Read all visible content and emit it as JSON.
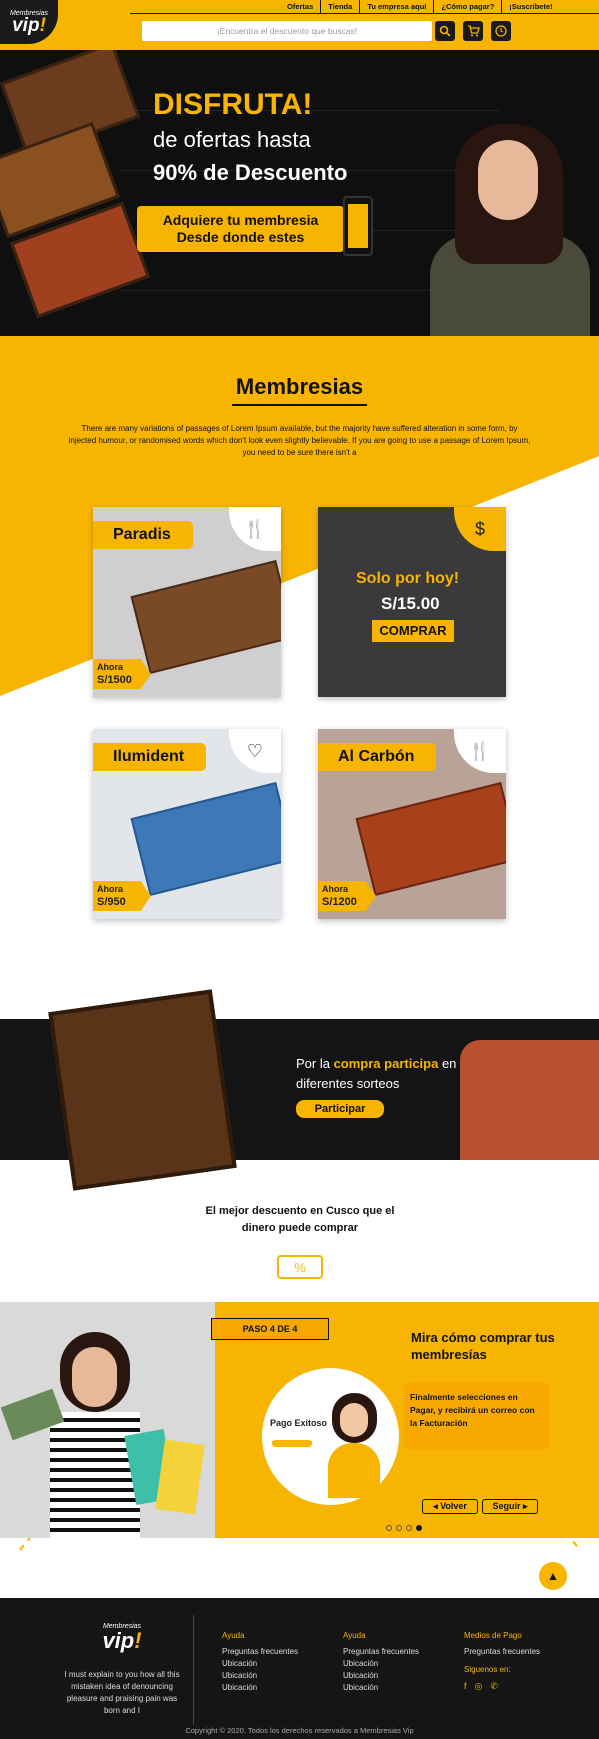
{
  "logo": {
    "line1": "Membresias",
    "line2_a": "vip",
    "line2_b": "!"
  },
  "topnav": [
    "Ofertas",
    "Tienda",
    "Tu empresa aquí",
    "¿Cómo pagar?",
    "¡Suscríbete!"
  ],
  "search": {
    "placeholder": "¡Encuentra el descuento que buscas!"
  },
  "hero": {
    "line1": "DISFRUTA!",
    "line2": "de ofertas hasta",
    "line3": "90% de Descuento",
    "button_line1": "Adquiere tu membresia",
    "button_line2": "Desde donde estes"
  },
  "membresias": {
    "title": "Membresias",
    "text": "There are many variations of passages of Lorem Ipsum available, but the majority have suffered alteration in some form, by injected humour, or randomised words which don't look even slightly believable. If you are going to use a passage of Lorem Ipsum, you need to be sure there isn't a"
  },
  "cards": [
    {
      "name": "Paradis",
      "ahora": "Ahora",
      "price": "S/1500"
    },
    {
      "promo": "Solo por hoy!",
      "price": "S/15.00",
      "button": "COMPRAR"
    },
    {
      "name": "Ilumident",
      "ahora": "Ahora",
      "price": "S/950"
    },
    {
      "name": "Al Carbón",
      "ahora": "Ahora",
      "price": "S/1200"
    }
  ],
  "band": {
    "text_a": "Por la ",
    "text_b": "compra participa",
    "text_c": " en diferentes sorteos",
    "button": "Participar"
  },
  "best": {
    "line1": "El mejor descuento en Cusco que el",
    "line2": "dinero puede comprar"
  },
  "steps": {
    "badge": "PASO 4 DE 4",
    "title": "Mira cómo comprar tus membresías",
    "circle_title": "Pago Exitoso",
    "description": "Finalmente selecciones en Pagar, y recibirá un correo con la Facturación",
    "back": "◂ Volver",
    "next": "Seguir ▸",
    "dots": [
      false,
      false,
      false,
      true
    ]
  },
  "footer": {
    "logo_line1": "Membresias",
    "logo_a": "vip",
    "logo_b": "!",
    "desc": "I must explain to you how all this mistaken idea of denouncing pleasure and praising pain was born and I",
    "col1": {
      "title": "Ayuda",
      "items": [
        "Preguntas frecuentes",
        "Ubicación",
        "Ubicación",
        "Ubicación"
      ]
    },
    "col2": {
      "title": "Ayuda",
      "items": [
        "Preguntas frecuentes",
        "Ubicación",
        "Ubicación",
        "Ubicación"
      ]
    },
    "col3": {
      "title": "Medios de Pago",
      "item": "Preguntas frecuentes",
      "follow": "Siguenos en:"
    },
    "copyright": "Copyright © 2020. Todos los derechos reservados a Membresias Vip"
  },
  "colors": {
    "accent": "#f7b400",
    "dark": "#151515"
  }
}
